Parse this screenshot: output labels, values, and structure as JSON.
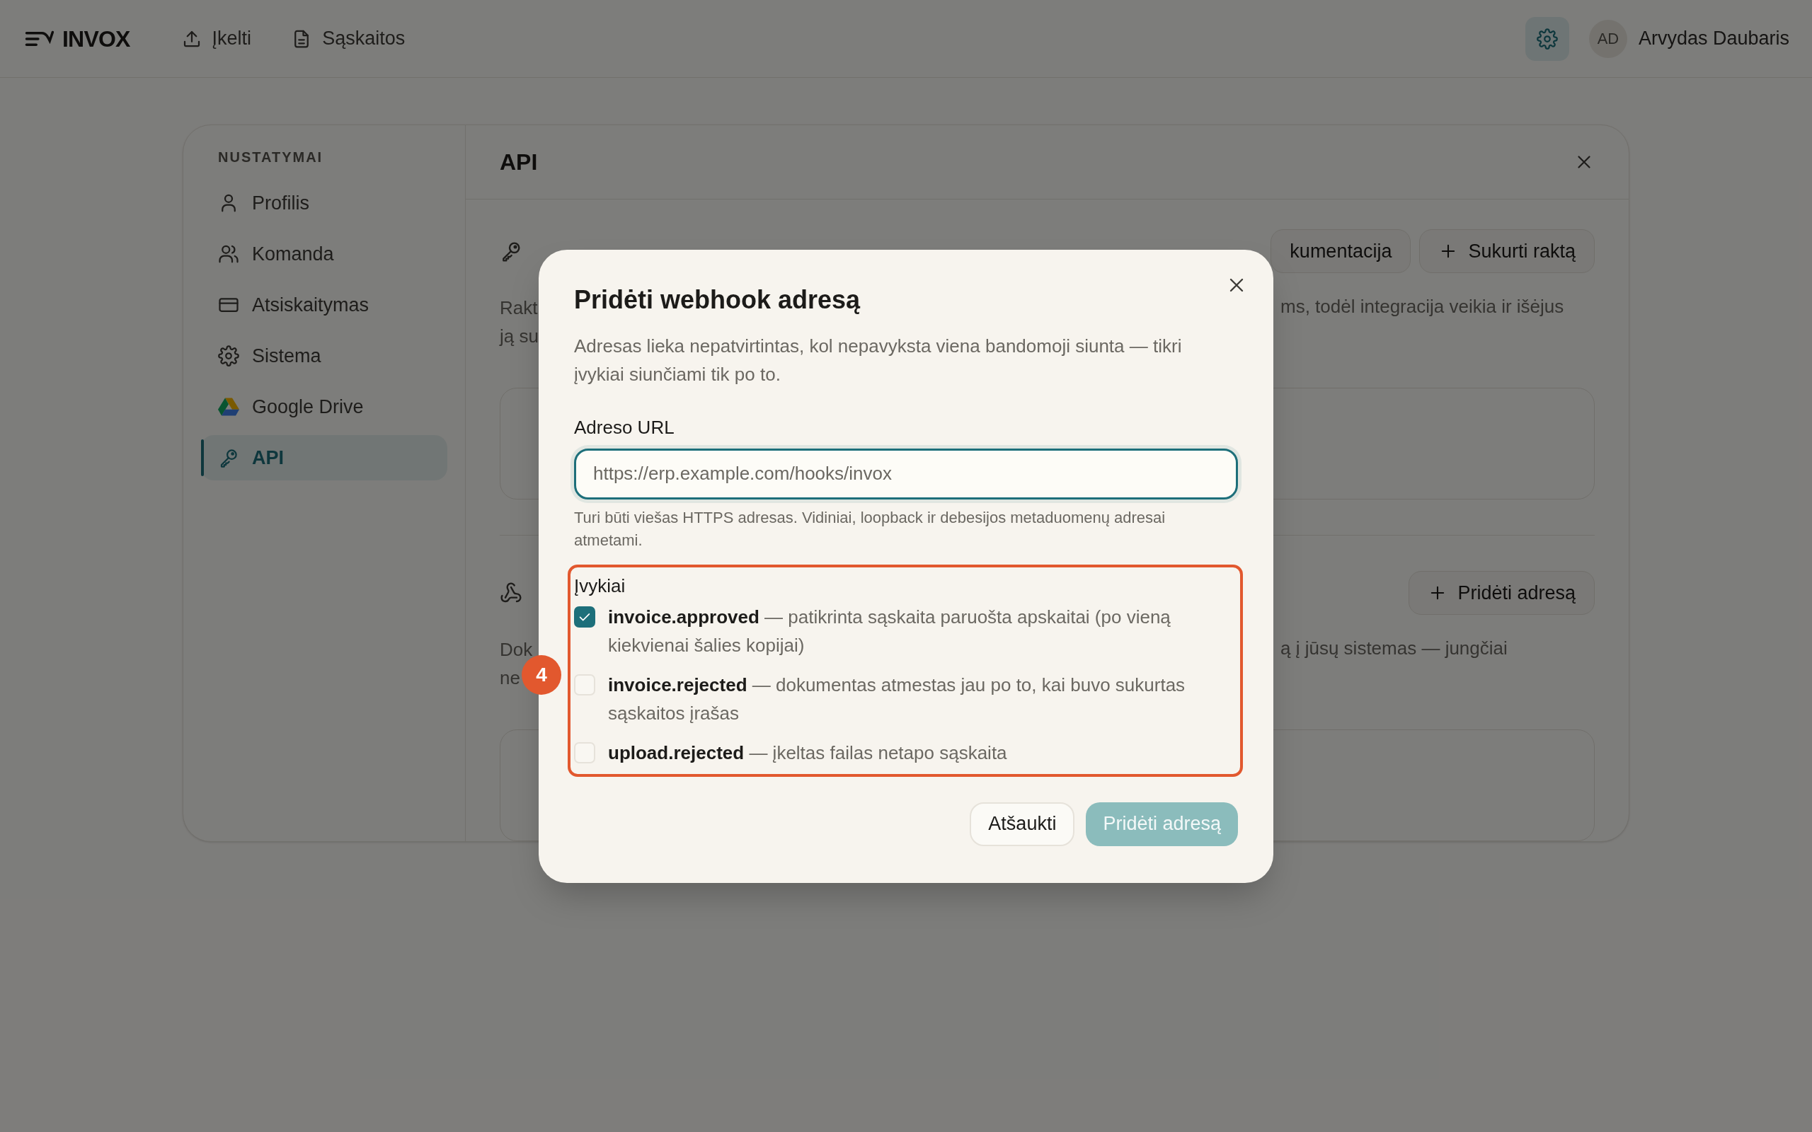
{
  "header": {
    "logo": "INVOX",
    "nav": [
      {
        "label": "Įkelti",
        "kind": "upload"
      },
      {
        "label": "Sąskaitos",
        "kind": "document"
      }
    ],
    "settings": {
      "selected": true
    },
    "user": {
      "initials": "AD",
      "name": "Arvydas Daubaris"
    }
  },
  "sidebar": {
    "heading": "NUSTATYMAI",
    "items": [
      {
        "label": "Profilis",
        "kind": "person",
        "selected": false
      },
      {
        "label": "Komanda",
        "kind": "people",
        "selected": false
      },
      {
        "label": "Atsiskaitymas",
        "kind": "card",
        "selected": false
      },
      {
        "label": "Sistema",
        "kind": "gear",
        "selected": false
      },
      {
        "label": "Google Drive",
        "kind": "drive",
        "selected": false
      },
      {
        "label": "API",
        "kind": "key",
        "selected": true
      }
    ]
  },
  "panel": {
    "title": "API",
    "sections": [
      {
        "kind": "key",
        "lines": [
          "Rakt",
          "ją su"
        ],
        "buttons": [
          {
            "label": "kumentacija",
            "kind": "link"
          },
          {
            "label": "Sukurti raktą",
            "kind": "add"
          }
        ],
        "right_text": "ms, todėl integracija veikia ir išėjus"
      },
      {
        "kind": "webhook",
        "lines": [
          "Dok",
          "ne"
        ],
        "buttons": [
          {
            "label": "Pridėti adresą",
            "kind": "add"
          }
        ],
        "right_text": "ą į jūsų sistemas — jungčiai"
      }
    ]
  },
  "dialog": {
    "title": "Pridėti webhook adresą",
    "description": "Adresas lieka nepatvirtintas, kol nepavyksta viena bandomoji siunta — tikri įvykiai siunčiami tik po to.",
    "url": {
      "label": "Adreso URL",
      "placeholder": "https://erp.example.com/hooks/invox",
      "hint": "Turi būti viešas HTTPS adresas. Vidiniai, loopback ir debesijos metaduomenų adresai atmetami."
    },
    "events": {
      "label": "Įvykiai",
      "items": [
        {
          "text": "**invoice.approved** — patikrinta sąskaita paruošta apskaitai (po vieną kiekvienai šalies kopijai)",
          "checked": true
        },
        {
          "text": "**invoice.rejected** — dokumentas atmestas jau po to, kai buvo sukurtas sąskaitos įrašas",
          "checked": false
        },
        {
          "text": "**upload.rejected** — įkeltas failas netapo sąskaita",
          "checked": false
        }
      ]
    },
    "buttons": [
      {
        "label": "Atšaukti",
        "kind": "secondary"
      },
      {
        "label": "Pridėti adresą",
        "kind": "primary",
        "disabled": true
      }
    ]
  },
  "annotation": {
    "label": "4"
  }
}
